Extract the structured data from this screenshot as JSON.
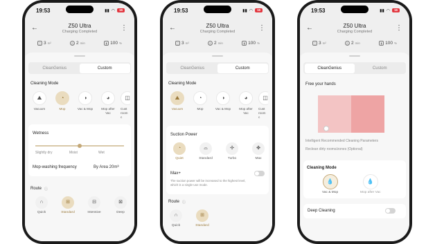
{
  "status": {
    "time": "19:53",
    "battery": "16",
    "signal": "..il",
    "wifi": "wifi"
  },
  "device": {
    "title": "Z50 Ultra",
    "subtitle": "Charging Completed"
  },
  "stats": {
    "area": "3",
    "area_unit": "m²",
    "time": "2",
    "time_unit": "min",
    "battery": "100",
    "battery_unit": "%"
  },
  "tabs": {
    "left": "CleanGenius",
    "right": "Custom"
  },
  "cleaning_mode_label": "Cleaning Mode",
  "modes": [
    {
      "label": "Vacuum",
      "icon": "vacuum-icon"
    },
    {
      "label": "Mop",
      "icon": "mop-icon"
    },
    {
      "label": "Vac & Mop",
      "icon": "vac-mop-icon"
    },
    {
      "label": "Mop after\nVac",
      "icon": "mop-after-vac-icon"
    },
    {
      "label": "Cust\nroom c",
      "icon": "custom-room-icon"
    }
  ],
  "wetness": {
    "label": "Wetness",
    "levels": [
      "Slightly dry",
      "Moist",
      "Wet"
    ],
    "position": 0.5
  },
  "mop_frequency": {
    "label": "Mop-washing frequency",
    "value": "By Area 20m²"
  },
  "route": {
    "label": "Route",
    "items": [
      {
        "label": "Quick",
        "icon": "quick-route-icon"
      },
      {
        "label": "Standard",
        "icon": "standard-route-icon"
      },
      {
        "label": "Intensive",
        "icon": "intensive-route-icon"
      },
      {
        "label": "Deep",
        "icon": "deep-route-icon"
      }
    ]
  },
  "suction": {
    "label": "Suction Power",
    "items": [
      {
        "label": "Quiet",
        "icon": "quiet-icon"
      },
      {
        "label": "Standard",
        "icon": "standard-suction-icon"
      },
      {
        "label": "Turbo",
        "icon": "turbo-icon"
      },
      {
        "label": "Max",
        "icon": "max-icon"
      }
    ]
  },
  "maxplus": {
    "label": "Max+",
    "desc": "The suction power will be increased to the highest level, which is a single-use mode."
  },
  "genius": {
    "heading": "Free your hands",
    "params": "Intelligent Recommended Cleaning Parameters",
    "reclean": "Reclean dirty rooms/zones (Optional)",
    "cleaning_mode": "Cleaning Mode",
    "opt1": "Vac & Mop",
    "opt2": "Mop after Vac",
    "deep": "Deep Cleaning"
  },
  "colors": {
    "accent": "#c4a877",
    "accent_bg": "#eadcbf",
    "map1": "#f3c4c4",
    "map2": "#eea4a4"
  }
}
